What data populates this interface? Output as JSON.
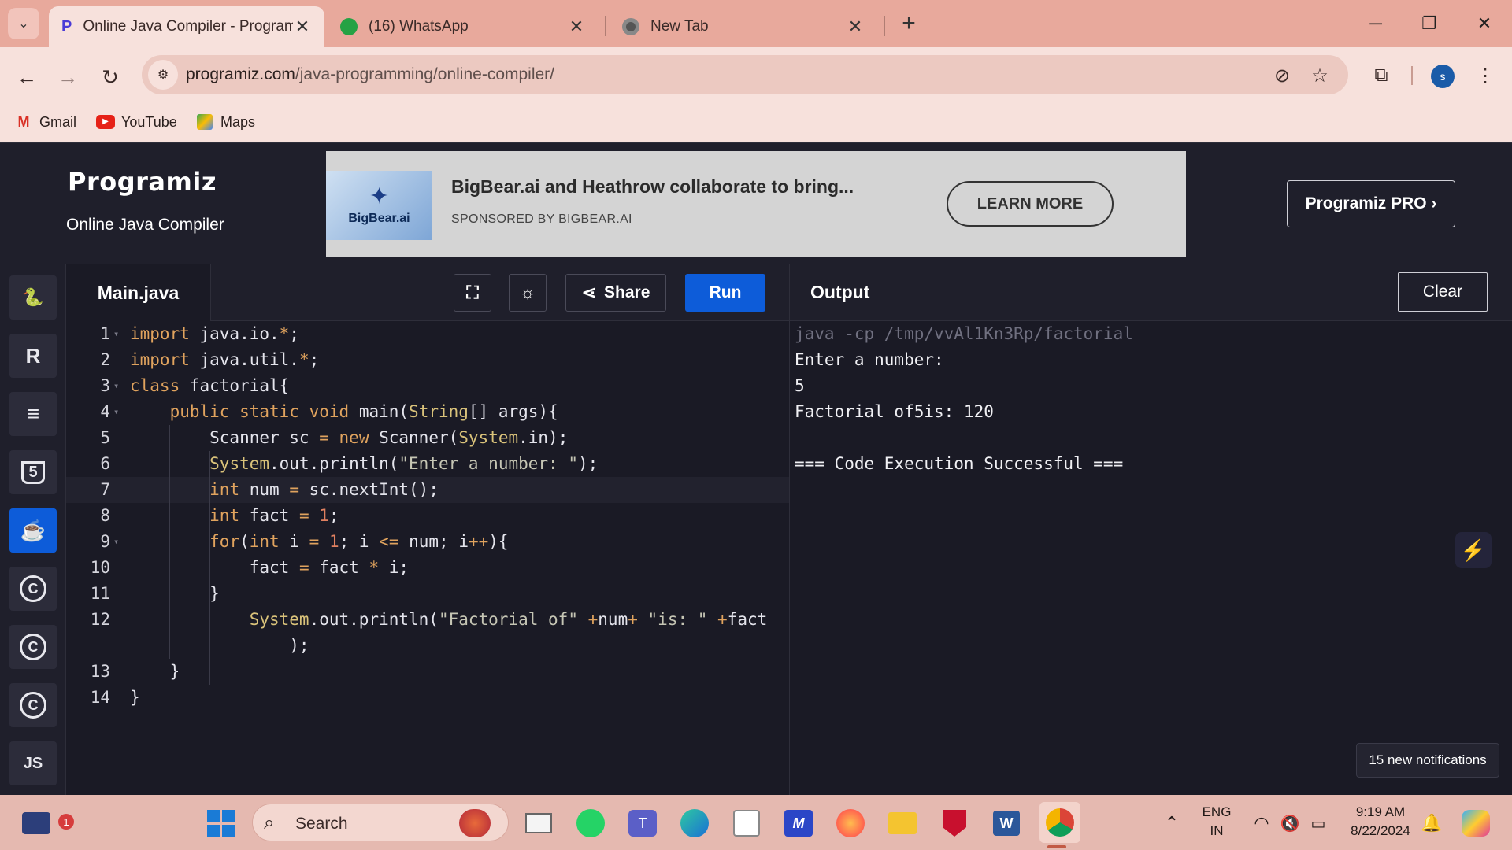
{
  "browser": {
    "tabs": [
      {
        "title": "Online Java Compiler - Program",
        "active": true
      },
      {
        "title": "(16) WhatsApp",
        "active": false
      },
      {
        "title": "New Tab",
        "active": false
      }
    ],
    "new_tab_label": "+",
    "url_host": "programiz.com",
    "url_path": "/java-programming/online-compiler/",
    "profile_initial": "s",
    "bookmarks": [
      {
        "label": "Gmail"
      },
      {
        "label": "YouTube"
      },
      {
        "label": "Maps"
      }
    ]
  },
  "site": {
    "logo": "Programiz",
    "subtitle": "Online Java Compiler",
    "pro_button": "Programiz PRO ›",
    "ad": {
      "brand": "BigBear.ai",
      "title": "BigBear.ai and Heathrow collaborate to bring...",
      "sponsor": "SPONSORED BY BIGBEAR.AI",
      "cta": "LEARN MORE"
    }
  },
  "languages": [
    {
      "name": "python-icon",
      "label": "🐍",
      "active": false
    },
    {
      "name": "r-icon",
      "label": "R",
      "active": false
    },
    {
      "name": "sql-icon",
      "label": "≡",
      "active": false
    },
    {
      "name": "html-icon",
      "label": "5",
      "active": false
    },
    {
      "name": "java-icon",
      "label": "☕",
      "active": true
    },
    {
      "name": "c-icon",
      "label": "C",
      "active": false
    },
    {
      "name": "cpp-icon",
      "label": "C",
      "active": false
    },
    {
      "name": "csharp-icon",
      "label": "C",
      "active": false
    },
    {
      "name": "js-icon",
      "label": "JS",
      "active": false
    }
  ],
  "editor": {
    "file_name": "Main.java",
    "share_label": "Share",
    "run_label": "Run",
    "current_line": 7,
    "lines": [
      {
        "n": "1",
        "fold": true,
        "html": "<span class=\"kw\">import</span> java.io.<span class=\"op\">*</span>;"
      },
      {
        "n": "2",
        "fold": false,
        "html": "<span class=\"kw\">import</span> java.util.<span class=\"op\">*</span>;"
      },
      {
        "n": "3",
        "fold": true,
        "html": "<span class=\"kw\">class</span> factorial{"
      },
      {
        "n": "4",
        "fold": true,
        "html": "    <span class=\"kw\">public</span> <span class=\"kw\">static</span> <span class=\"kw\">void</span> main(<span class=\"cls\">String</span>[] args){"
      },
      {
        "n": "5",
        "fold": false,
        "html": "        Scanner sc <span class=\"op\">=</span> <span class=\"kw\">new</span> Scanner(<span class=\"cls\">System</span>.in);"
      },
      {
        "n": "6",
        "fold": false,
        "html": "        <span class=\"cls\">System</span>.out.println(<span class=\"str\">\"Enter a number: \"</span>);"
      },
      {
        "n": "7",
        "fold": false,
        "html": "        <span class=\"kw\">int</span> num <span class=\"op\">=</span> sc.nextInt();"
      },
      {
        "n": "8",
        "fold": false,
        "html": "        <span class=\"kw\">int</span> fact <span class=\"op\">=</span> <span class=\"num\">1</span>;"
      },
      {
        "n": "9",
        "fold": true,
        "html": "        <span class=\"kw\">for</span>(<span class=\"kw\">int</span> i <span class=\"op\">=</span> <span class=\"num\">1</span>; i <span class=\"op\">&lt;=</span> num; i<span class=\"op\">++</span>){"
      },
      {
        "n": "10",
        "fold": false,
        "html": "            fact <span class=\"op\">=</span> fact <span class=\"op\">*</span> i;"
      },
      {
        "n": "11",
        "fold": false,
        "html": "        }"
      },
      {
        "n": "12",
        "fold": false,
        "html": "            <span class=\"cls\">System</span>.out.println(<span class=\"str\">\"Factorial of\"</span> <span class=\"op\">+</span>num<span class=\"op\">+</span> <span class=\"str\">\"is: \"</span> <span class=\"op\">+</span>fact"
      },
      {
        "n": "",
        "fold": false,
        "html": "                );"
      },
      {
        "n": "13",
        "fold": false,
        "html": "    }"
      },
      {
        "n": "14",
        "fold": false,
        "html": "}"
      }
    ]
  },
  "output": {
    "title": "Output",
    "clear_label": "Clear",
    "lines": [
      {
        "text": "java -cp /tmp/vvAl1Kn3Rp/factorial",
        "cmd": true
      },
      {
        "text": "Enter a number:",
        "cmd": false
      },
      {
        "text": "5",
        "cmd": false
      },
      {
        "text": "Factorial of5is: 120",
        "cmd": false
      },
      {
        "text": "",
        "cmd": false
      },
      {
        "text": "=== Code Execution Successful ===",
        "cmd": false
      }
    ]
  },
  "notifications": {
    "chip": "15 new notifications"
  },
  "taskbar": {
    "search_placeholder": "Search",
    "notification_badge": "1",
    "language_top": "ENG",
    "language_bottom": "IN",
    "time": "9:19 AM",
    "date": "8/22/2024"
  },
  "colors": {
    "accent": "#0d5cd9",
    "browser_frame": "#e8a99c",
    "page_bg": "#1a1a25"
  }
}
